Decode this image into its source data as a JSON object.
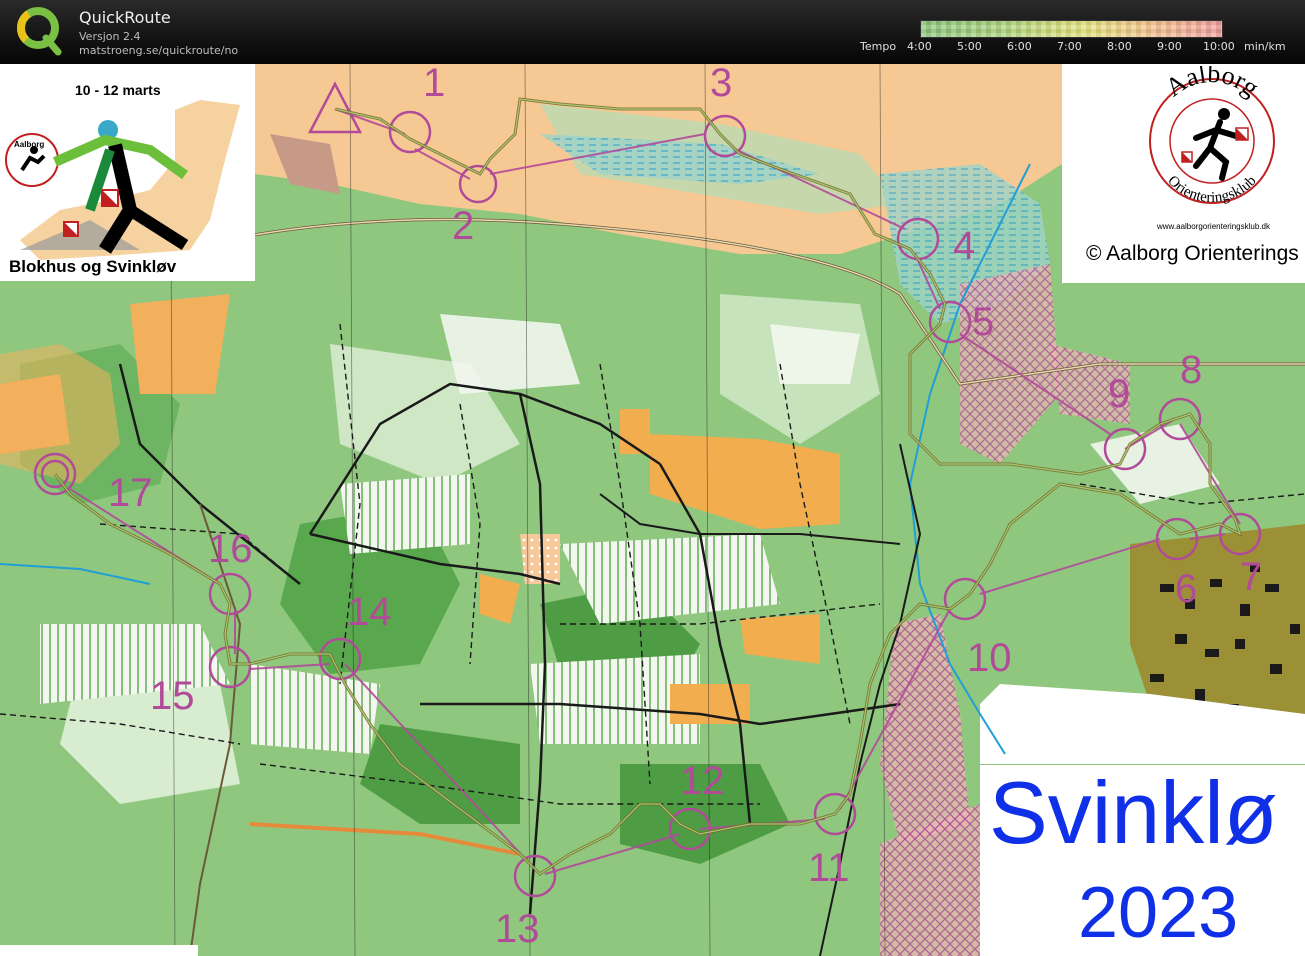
{
  "app": {
    "title": "QuickRoute",
    "version": "Versjon 2.4",
    "url": "matstroeng.se/quickroute/no"
  },
  "tempo": {
    "label": "Tempo",
    "ticks": [
      "4:00",
      "5:00",
      "6:00",
      "7:00",
      "8:00",
      "9:00",
      "10:00"
    ],
    "unit": "min/km"
  },
  "event": {
    "dates": "10 - 12 marts",
    "name": "Blokhus og Svinkløv",
    "logo_club_text": "Aalborg"
  },
  "club": {
    "name_arc": "Aalborg",
    "subtitle_arc": "Orienteringsklub",
    "url": "www.aalborgorienteringsklub.dk",
    "copyright": "© Aalborg Orienterings"
  },
  "map_title": {
    "word": "Svinklø",
    "year": "2023"
  },
  "controls": [
    "1",
    "2",
    "3",
    "4",
    "5",
    "6",
    "7",
    "8",
    "9",
    "10",
    "11",
    "12",
    "13",
    "14",
    "15",
    "16",
    "17"
  ],
  "colors": {
    "course": "#b24a9a",
    "title_blue": "#1030e8",
    "route": "#7a6a2a"
  }
}
